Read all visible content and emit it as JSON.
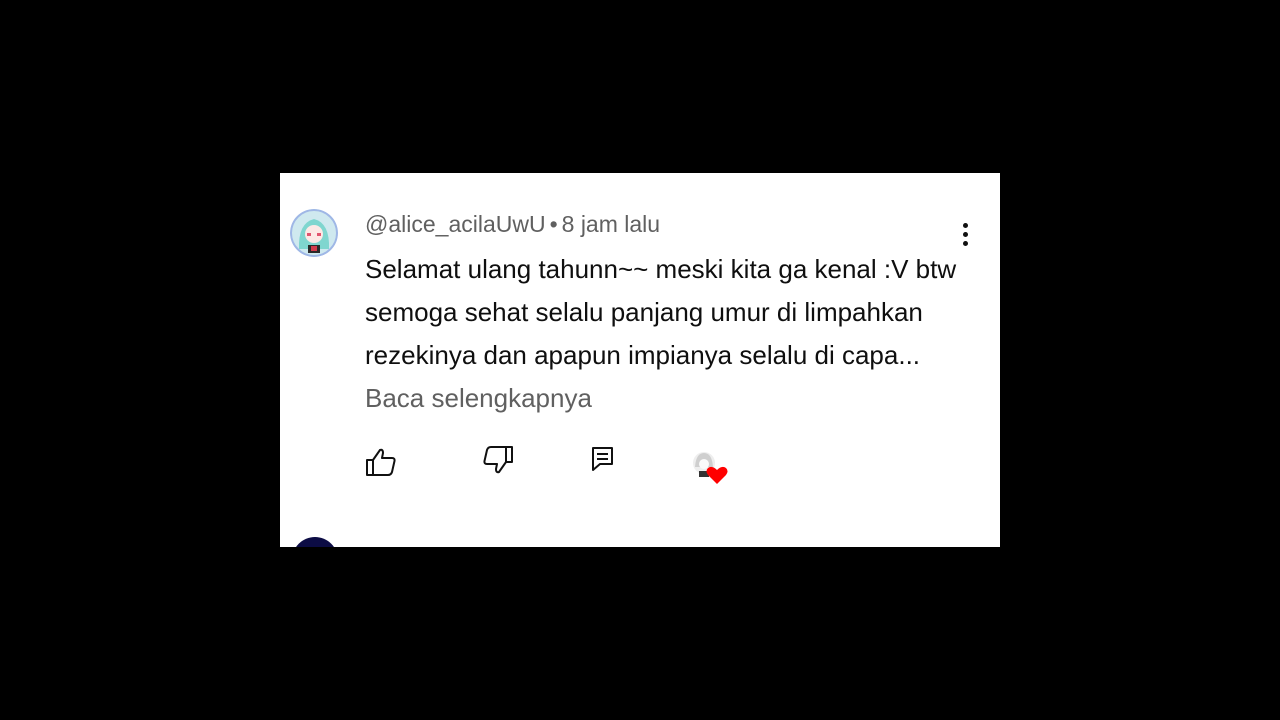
{
  "comment": {
    "author": "@alice_acilaUwU",
    "separator": "•",
    "time": "8 jam lalu",
    "text": "Selamat ulang tahunn~~ meski kita ga kenal :V btw semoga sehat selalu panjang umur di limpahkan rezekinya dan apapun impianya selalu di capa...",
    "read_more": "Baca selengkapnya"
  },
  "colors": {
    "heart": "#ff0000",
    "text": "#0f0f0f",
    "meta": "#606060"
  },
  "icons": [
    "avatar",
    "more-vert-icon",
    "like-icon",
    "dislike-icon",
    "reply-icon",
    "creator-heart-icon"
  ]
}
